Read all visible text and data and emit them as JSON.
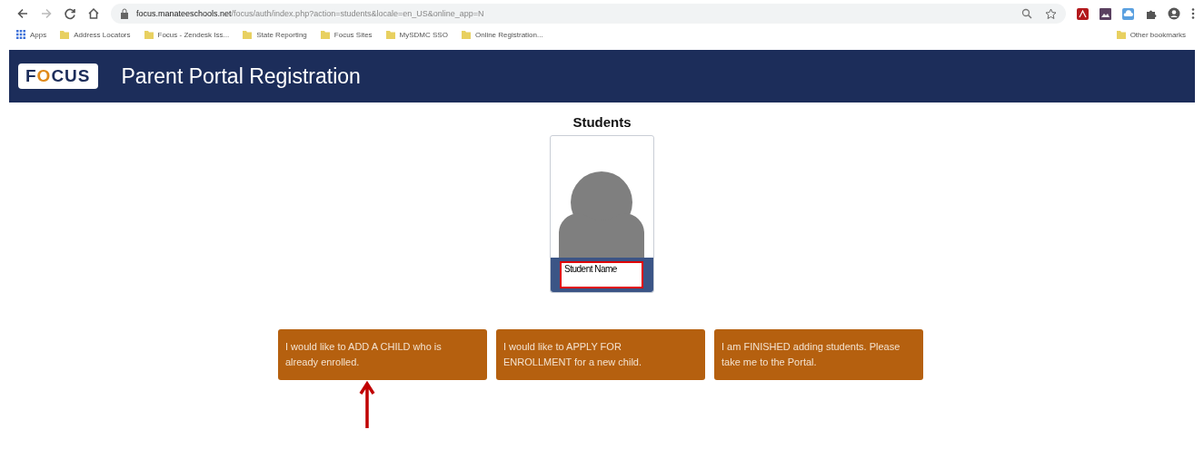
{
  "browser": {
    "url_host": "focus.manateeschools.net",
    "url_path": "/focus/auth/index.php?action=students&locale=en_US&online_app=N",
    "bookmarks": [
      {
        "label": "Apps",
        "kind": "apps"
      },
      {
        "label": "Address Locators",
        "kind": "folder"
      },
      {
        "label": "Focus - Zendesk Iss...",
        "kind": "folder"
      },
      {
        "label": "State Reporting",
        "kind": "folder"
      },
      {
        "label": "Focus Sites",
        "kind": "folder"
      },
      {
        "label": "MySDMC SSO",
        "kind": "folder"
      },
      {
        "label": "Online Registration...",
        "kind": "folder"
      }
    ],
    "other_bookmarks": "Other bookmarks"
  },
  "header": {
    "logo": "FOCUS",
    "title": "Parent Portal Registration"
  },
  "students": {
    "heading": "Students",
    "cards": [
      {
        "name": "Student Name",
        "highlighted": true
      }
    ]
  },
  "actions": [
    {
      "label": "I would like to ADD A CHILD who is already enrolled.",
      "pointed": true
    },
    {
      "label": "I would like to APPLY FOR ENROLLMENT for a new child.",
      "pointed": false
    },
    {
      "label": "I am FINISHED adding students. Please take me to the Portal.",
      "pointed": false
    }
  ]
}
